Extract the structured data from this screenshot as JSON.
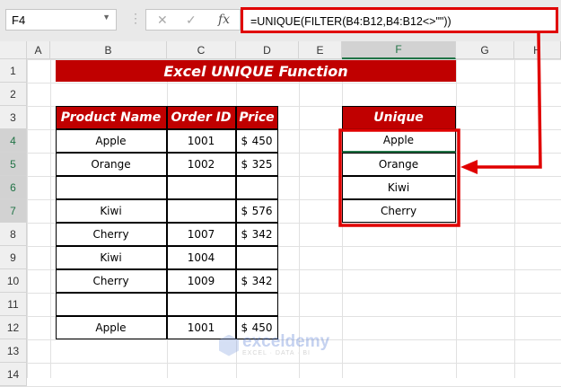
{
  "name_box": "F4",
  "formula_bar": {
    "cancel_icon": "✕",
    "enter_icon": "✓",
    "fx_label": "fx",
    "formula": "=UNIQUE(FILTER(B4:B12,B4:B12<>\"\"))"
  },
  "columns": [
    "A",
    "B",
    "C",
    "D",
    "E",
    "F",
    "G",
    "H"
  ],
  "rows": [
    "1",
    "2",
    "3",
    "4",
    "5",
    "6",
    "7",
    "8",
    "9",
    "10",
    "11",
    "12",
    "13",
    "14"
  ],
  "title": "Excel UNIQUE Function",
  "table": {
    "headers": [
      "Product Name",
      "Order ID",
      "Price"
    ],
    "rows": [
      [
        "Apple",
        "1001",
        "$",
        "450"
      ],
      [
        "Orange",
        "1002",
        "$",
        "325"
      ],
      [
        "",
        "",
        "",
        ""
      ],
      [
        "Kiwi",
        "",
        "$",
        "576"
      ],
      [
        "Cherry",
        "1007",
        "$",
        "342"
      ],
      [
        "Kiwi",
        "1004",
        "",
        ""
      ],
      [
        "Cherry",
        "1009",
        "$",
        "342"
      ],
      [
        "",
        "",
        "",
        ""
      ],
      [
        "Apple",
        "1001",
        "$",
        "450"
      ]
    ]
  },
  "unique": {
    "header": "Unique",
    "values": [
      "Apple",
      "Orange",
      "Kiwi",
      "Cherry"
    ]
  },
  "watermark": {
    "name": "exceldemy",
    "tagline": "EXCEL · DATA · BI"
  },
  "colors": {
    "header_red": "#c00000",
    "highlight_red": "#e00000",
    "selection_green": "#217346"
  }
}
